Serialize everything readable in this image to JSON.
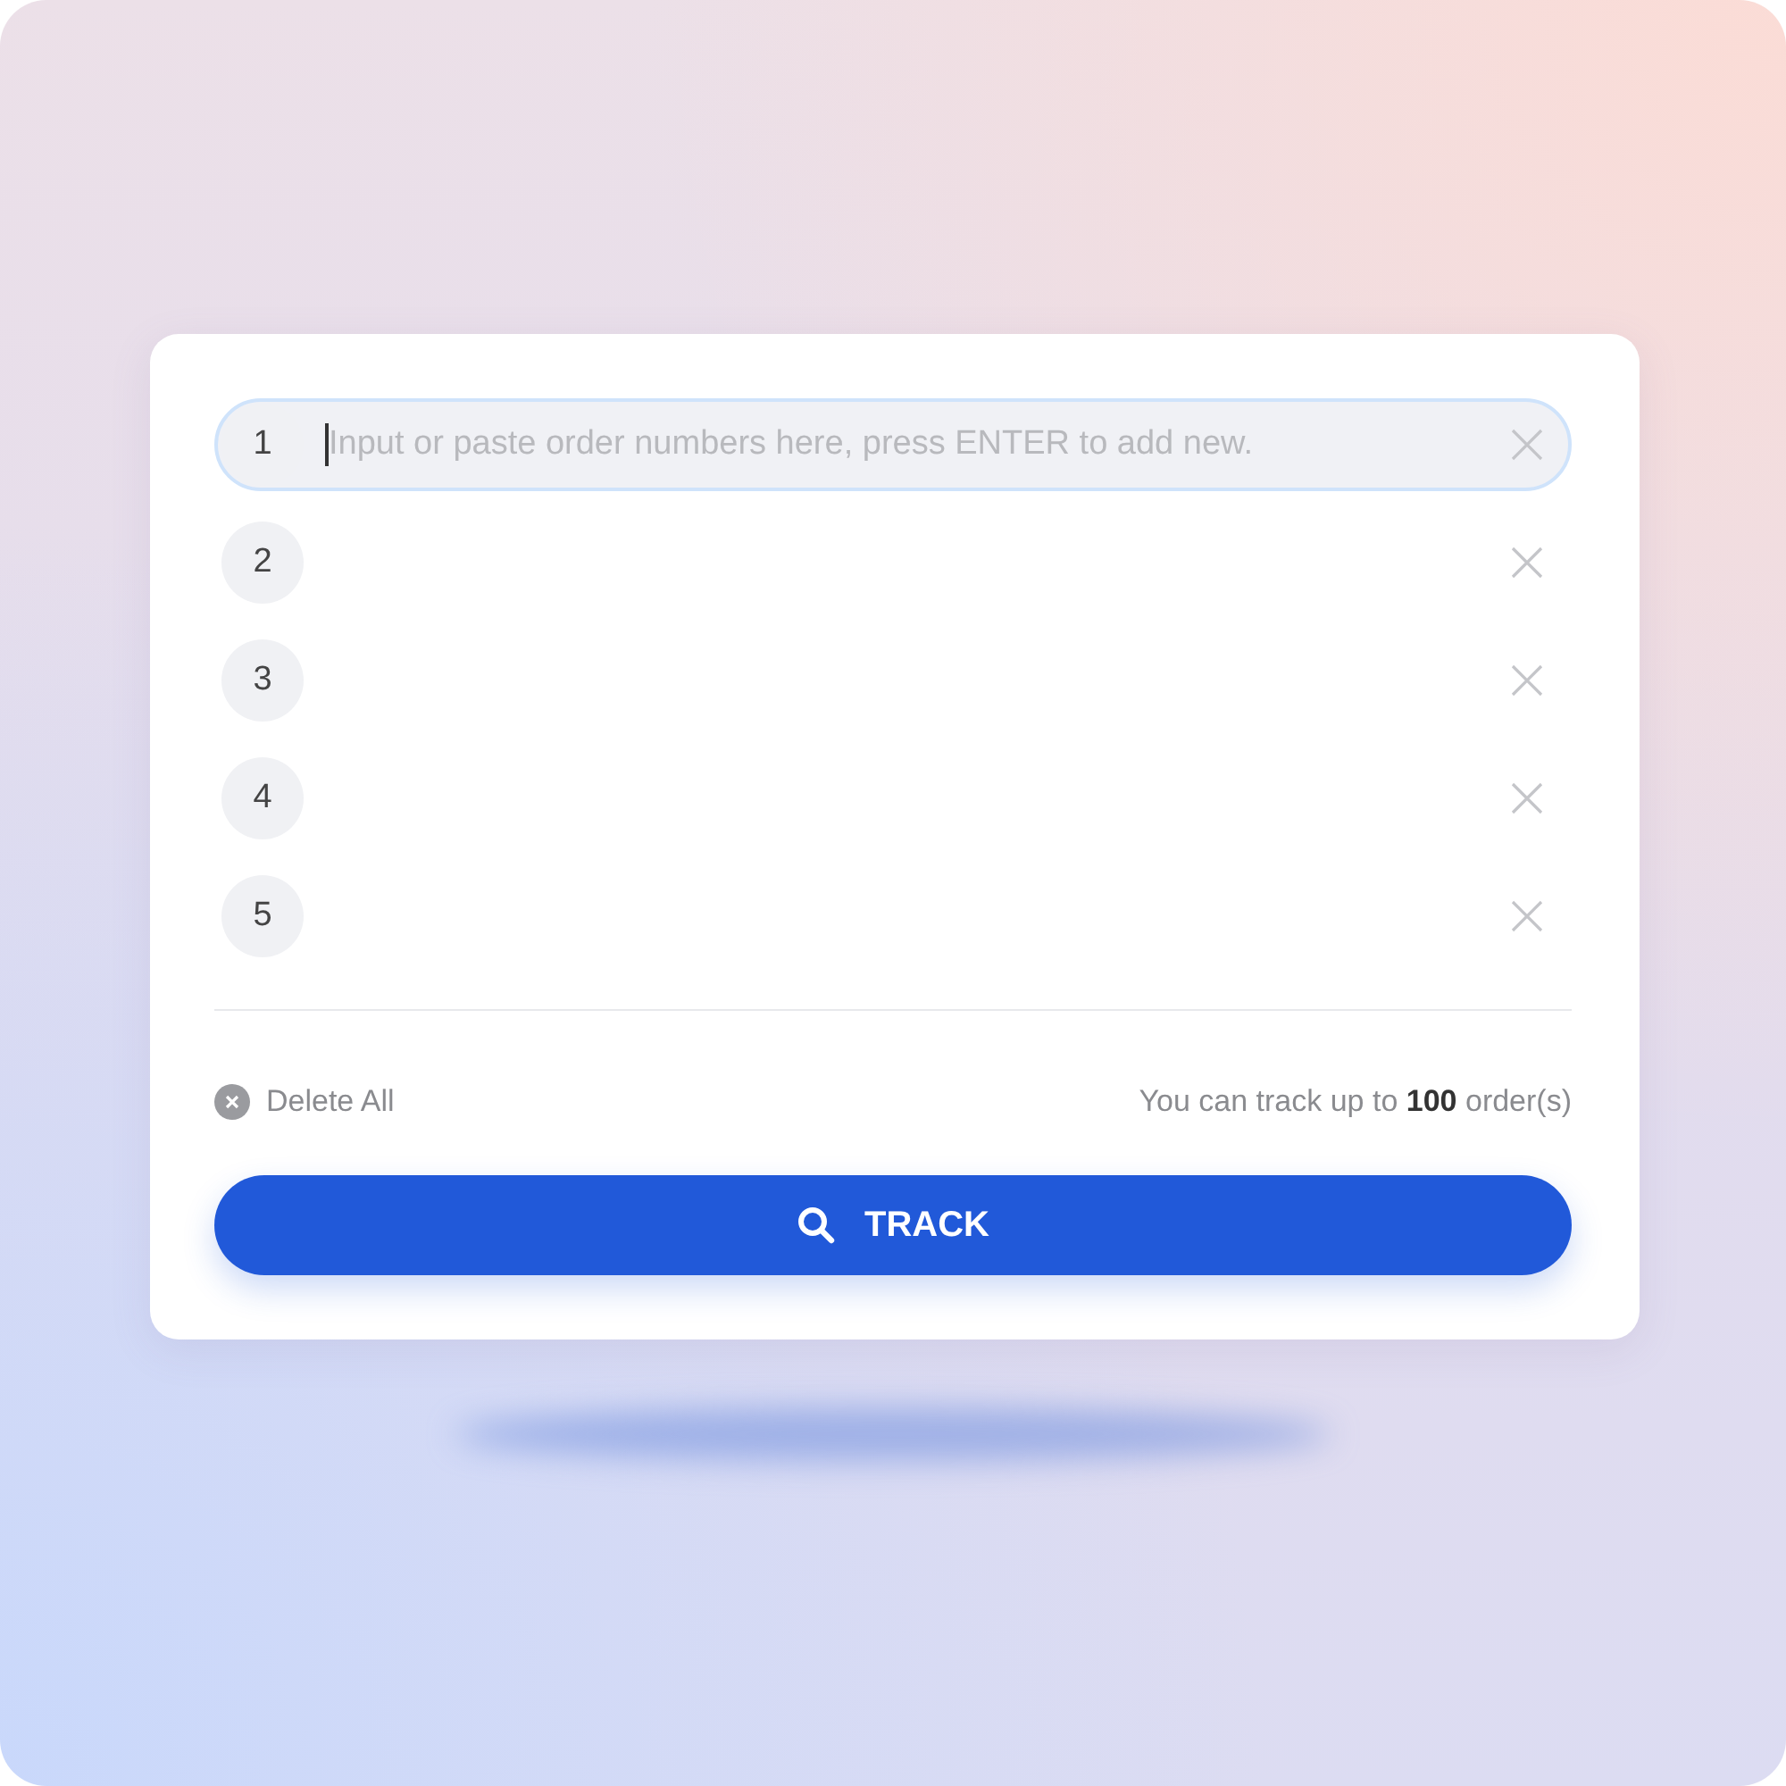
{
  "orders": [
    {
      "number": "1",
      "focused": true,
      "placeholder": "Input or paste order numbers here, press ENTER to add new."
    },
    {
      "number": "2",
      "focused": false
    },
    {
      "number": "3",
      "focused": false
    },
    {
      "number": "4",
      "focused": false
    },
    {
      "number": "5",
      "focused": false
    }
  ],
  "delete_all": "Delete All",
  "limit_note": "You can track up to **100** order(s)",
  "track_button": "TRACK"
}
